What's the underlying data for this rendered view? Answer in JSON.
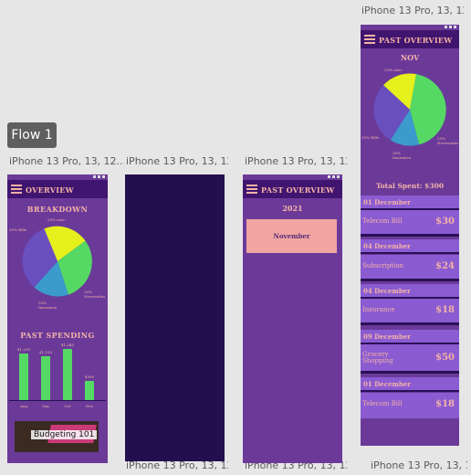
{
  "flow": {
    "label": "Flow 1"
  },
  "frame_label": "iPhone 13 Pro, 13, 12...",
  "overview": {
    "title": "OVERVIEW",
    "breakdown_title": "BREAKDOWN",
    "pie_labels": {
      "misc": "20% misc",
      "bills": "35% Bills",
      "necessities": "30% Necessities",
      "insurance": "20% Insurance"
    },
    "past_spending_title": "PAST SPENDING",
    "chart_data": {
      "type": "bar",
      "categories": [
        "Aug",
        "Sep",
        "Oct",
        "Nov"
      ],
      "values": [
        1235,
        1150,
        1345,
        500
      ],
      "value_labels": [
        "$1,235",
        "$1,150",
        "$1,345",
        "$500"
      ],
      "ylim": [
        0,
        1400
      ]
    },
    "banner_text": "Budgeting 101"
  },
  "past_overview_year": {
    "title": "PAST OVERVIEW",
    "year": "2021",
    "month_button": "November"
  },
  "past_overview_detail": {
    "title": "PAST OVERVIEW",
    "month": "NOV",
    "pie_labels": {
      "misc": "20% misc",
      "bills": "35% Bills",
      "necessities": "25% Necessities",
      "insurance": "20% Insurance"
    },
    "total_spent": "Total Spent: $300",
    "transactions": [
      {
        "date": "01 December",
        "label": "Telecom Bill",
        "amount": "$30"
      },
      {
        "date": "04 December",
        "label": "Subscription",
        "amount": "$24"
      },
      {
        "date": "04 December",
        "label": "Insurance",
        "amount": "$18"
      },
      {
        "date": "09 December",
        "label": "Grocery Shopping",
        "amount": "$50"
      },
      {
        "date": "01 December",
        "label": "Telecom Bill",
        "amount": "$18"
      }
    ]
  },
  "colors": {
    "canvas": "#e6e6e6",
    "screen": "#6b3a99",
    "appbar": "#40156f",
    "accent": "#f4b3a6",
    "bar": "#55d964",
    "dark_screen": "#240e4e"
  }
}
